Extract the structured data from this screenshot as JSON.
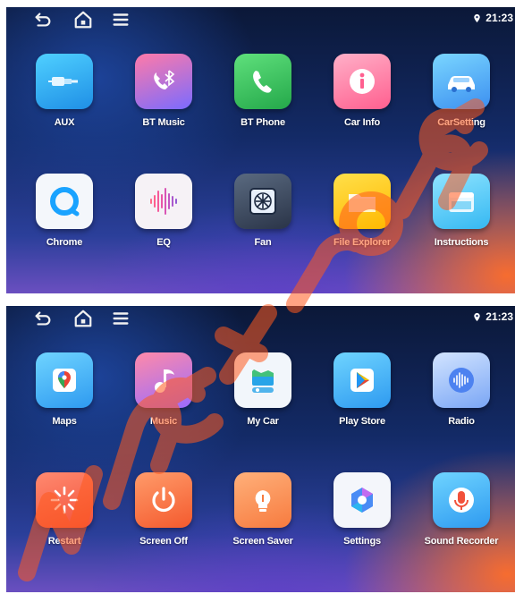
{
  "status": {
    "time": "21:23"
  },
  "colors": {
    "watermark": "#ff5a1e",
    "accent": "#ffffff"
  },
  "top_screen": {
    "apps": [
      {
        "label": "AUX",
        "icon": "aux-cable-icon"
      },
      {
        "label": "BT Music",
        "icon": "bluetooth-music-icon"
      },
      {
        "label": "BT Phone",
        "icon": "phone-icon"
      },
      {
        "label": "Car Info",
        "icon": "info-icon"
      },
      {
        "label": "CarSetting",
        "icon": "car-icon"
      },
      {
        "label": "Chrome",
        "icon": "chrome-icon"
      },
      {
        "label": "EQ",
        "icon": "equalizer-icon"
      },
      {
        "label": "Fan",
        "icon": "fan-icon"
      },
      {
        "label": "File Explorer",
        "icon": "folder-icon"
      },
      {
        "label": "Instructions",
        "icon": "instructions-icon"
      }
    ]
  },
  "bottom_screen": {
    "apps": [
      {
        "label": "Maps",
        "icon": "maps-icon"
      },
      {
        "label": "Music",
        "icon": "music-note-icon"
      },
      {
        "label": "My Car",
        "icon": "my-car-icon"
      },
      {
        "label": "Play Store",
        "icon": "play-store-icon"
      },
      {
        "label": "Radio",
        "icon": "radio-icon"
      },
      {
        "label": "Restart",
        "icon": "restart-icon"
      },
      {
        "label": "Screen Off",
        "icon": "power-icon"
      },
      {
        "label": "Screen Saver",
        "icon": "bulb-icon"
      },
      {
        "label": "Settings",
        "icon": "settings-icon"
      },
      {
        "label": "Sound Recorder",
        "icon": "microphone-icon"
      }
    ]
  }
}
